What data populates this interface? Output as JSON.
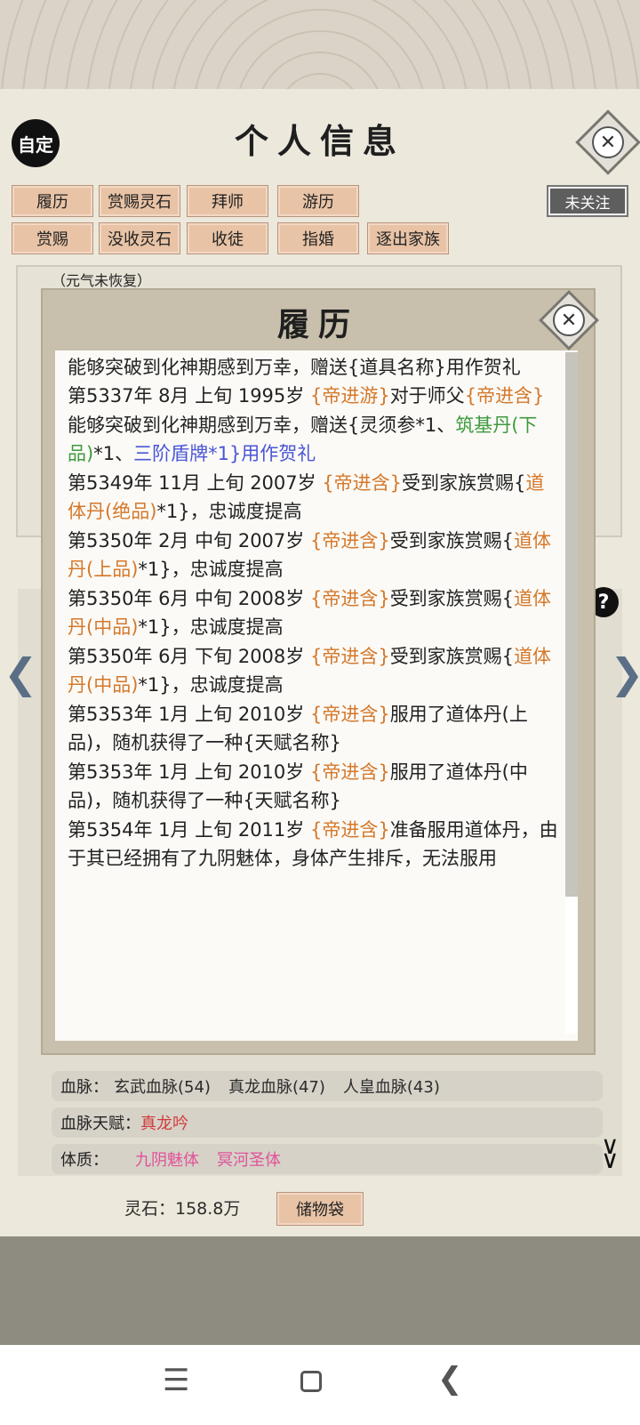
{
  "header": {
    "title": "个人信息",
    "badge": "自定",
    "follow_label": "未关注"
  },
  "tabs_row1": [
    "履历",
    "赏赐灵石",
    "拜师",
    "游历"
  ],
  "tabs_row2": [
    "赏赐",
    "没收灵石",
    "收徒",
    "指婚",
    "逐出家族"
  ],
  "background": {
    "status_note": "（元气未恢复）",
    "bloodline_label": "血脉：",
    "bloodlines": [
      "玄武血脉(54)",
      "真龙血脉(47)",
      "人皇血脉(43)"
    ],
    "bloodline_talent_label": "血脉天赋：",
    "bloodline_talent": "真龙吟",
    "physique_label": "体质：",
    "physiques": [
      "九阴魅体",
      "冥河圣体"
    ],
    "spirit_stones": "灵石：158.8万",
    "storage_button": "储物袋"
  },
  "dialog": {
    "title": "履历",
    "entries": [
      [
        {
          "t": "第5337年 8月 上旬  1995岁 "
        },
        {
          "t": "{帝进游}",
          "c": "o"
        },
        {
          "t": "对于师父"
        },
        {
          "t": "{帝进含}",
          "c": "o"
        },
        {
          "t": "能够突破到化神期感到万幸，赠送{道具名称}用作贺礼"
        }
      ],
      [
        {
          "t": "第5337年 8月 上旬  1995岁  "
        },
        {
          "t": "{帝进游}",
          "c": "o"
        },
        {
          "t": "对于师父"
        },
        {
          "t": "{帝进含}",
          "c": "o"
        },
        {
          "t": "能够突破到化神期感到万幸，赠送{灵须参*1、"
        },
        {
          "t": "筑基丹(下品)",
          "c": "g"
        },
        {
          "t": "*1、"
        },
        {
          "t": "三阶盾牌*1}用作贺礼",
          "c": "b"
        }
      ],
      [
        {
          "t": "第5349年 11月 上旬 2007岁 "
        },
        {
          "t": "{帝进含}",
          "c": "o"
        },
        {
          "t": "受到家族赏赐{"
        },
        {
          "t": "道体丹(绝品)",
          "c": "o"
        },
        {
          "t": "*1}，忠诚度提高"
        }
      ],
      [
        {
          "t": "第5350年 2月 中旬  2007岁  "
        },
        {
          "t": "{帝进含}",
          "c": "o"
        },
        {
          "t": "受到家族赏赐{"
        },
        {
          "t": "道体丹(上品)",
          "c": "o"
        },
        {
          "t": "*1}，忠诚度提高"
        }
      ],
      [
        {
          "t": "第5350年 6月 中旬  2008岁  "
        },
        {
          "t": "{帝进含}",
          "c": "o"
        },
        {
          "t": "受到家族赏赐{"
        },
        {
          "t": "道体丹(中品)",
          "c": "o"
        },
        {
          "t": "*1}，忠诚度提高"
        }
      ],
      [
        {
          "t": "第5350年 6月 下旬  2008岁  "
        },
        {
          "t": "{帝进含}",
          "c": "o"
        },
        {
          "t": "受到家族赏赐{"
        },
        {
          "t": "道体丹(中品)",
          "c": "o"
        },
        {
          "t": "*1}，忠诚度提高"
        }
      ],
      [
        {
          "t": "第5353年 1月 上旬  2010岁  "
        },
        {
          "t": "{帝进含}",
          "c": "o"
        },
        {
          "t": "服用了道体丹(上品)，随机获得了一种{天赋名称}"
        }
      ],
      [
        {
          "t": "第5353年 1月 上旬  2010岁  "
        },
        {
          "t": "{帝进含}",
          "c": "o"
        },
        {
          "t": "服用了道体丹(中品)，随机获得了一种{天赋名称}"
        }
      ],
      [
        {
          "t": "第5354年 1月 上旬 2011岁 "
        },
        {
          "t": "{帝进含}",
          "c": "o"
        },
        {
          "t": "准备服用道体丹，由于其已经拥有了九阴魅体，身体产生排斥，无法服用"
        }
      ]
    ]
  },
  "colors": {
    "orange": "#d5782a",
    "green": "#3e9a3e",
    "blue": "#4b55d6",
    "pink": "#e0529a",
    "red": "#d23a3a"
  },
  "icons": [
    "close-icon",
    "help-icon",
    "chevron-left-icon",
    "chevron-right-icon",
    "double-chevron-down-icon",
    "menu-icon",
    "home-icon",
    "back-icon"
  ]
}
